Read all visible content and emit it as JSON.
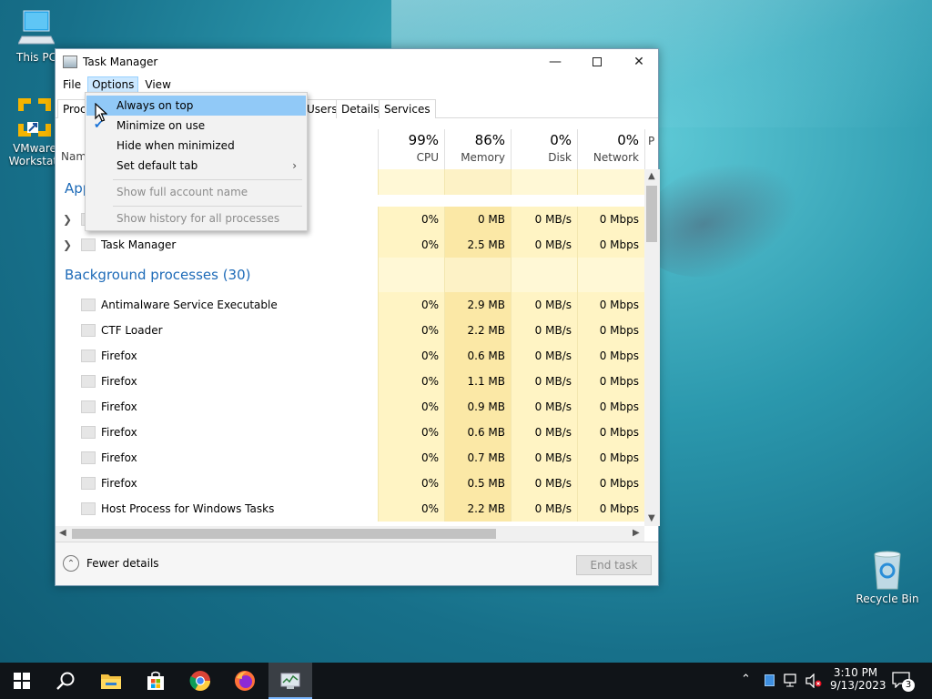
{
  "desktop": {
    "icons": [
      {
        "label": "This PC"
      },
      {
        "label": "VMware Workstati"
      },
      {
        "label": "Recycle Bin"
      }
    ]
  },
  "window": {
    "title": "Task Manager",
    "menu": [
      "File",
      "Options",
      "View"
    ],
    "tabs": [
      "Proc",
      "Users",
      "Details",
      "Services"
    ],
    "name_header": "Nam",
    "columns": [
      {
        "pct": "99%",
        "label": "CPU"
      },
      {
        "pct": "86%",
        "label": "Memory"
      },
      {
        "pct": "0%",
        "label": "Disk"
      },
      {
        "pct": "0%",
        "label": "Network"
      },
      {
        "pct": "",
        "label": "P"
      }
    ],
    "apps_group": "App",
    "apps": [
      {
        "name": "",
        "cpu": "0%",
        "mem": "0 MB",
        "disk": "0 MB/s",
        "net": "0 Mbps"
      },
      {
        "name": "Task Manager",
        "cpu": "0%",
        "mem": "2.5 MB",
        "disk": "0 MB/s",
        "net": "0 Mbps"
      }
    ],
    "bg_group": "Background processes (30)",
    "bg": [
      {
        "name": "Antimalware Service Executable",
        "cpu": "0%",
        "mem": "2.9 MB",
        "disk": "0 MB/s",
        "net": "0 Mbps"
      },
      {
        "name": "CTF Loader",
        "cpu": "0%",
        "mem": "2.2 MB",
        "disk": "0 MB/s",
        "net": "0 Mbps"
      },
      {
        "name": "Firefox",
        "cpu": "0%",
        "mem": "0.6 MB",
        "disk": "0 MB/s",
        "net": "0 Mbps"
      },
      {
        "name": "Firefox",
        "cpu": "0%",
        "mem": "1.1 MB",
        "disk": "0 MB/s",
        "net": "0 Mbps"
      },
      {
        "name": "Firefox",
        "cpu": "0%",
        "mem": "0.9 MB",
        "disk": "0 MB/s",
        "net": "0 Mbps"
      },
      {
        "name": "Firefox",
        "cpu": "0%",
        "mem": "0.6 MB",
        "disk": "0 MB/s",
        "net": "0 Mbps"
      },
      {
        "name": "Firefox",
        "cpu": "0%",
        "mem": "0.7 MB",
        "disk": "0 MB/s",
        "net": "0 Mbps"
      },
      {
        "name": "Firefox",
        "cpu": "0%",
        "mem": "0.5 MB",
        "disk": "0 MB/s",
        "net": "0 Mbps"
      },
      {
        "name": "Host Process for Windows Tasks",
        "cpu": "0%",
        "mem": "2.2 MB",
        "disk": "0 MB/s",
        "net": "0 Mbps"
      }
    ],
    "fewer_details": "Fewer details",
    "end_task": "End task"
  },
  "options_menu": {
    "items": [
      {
        "label": "Always on top",
        "checked": false,
        "highlighted": true,
        "disabled": false,
        "submenu": false
      },
      {
        "label": "Minimize on use",
        "checked": true,
        "highlighted": false,
        "disabled": false,
        "submenu": false
      },
      {
        "label": "Hide when minimized",
        "checked": false,
        "highlighted": false,
        "disabled": false,
        "submenu": false
      },
      {
        "label": "Set default tab",
        "checked": false,
        "highlighted": false,
        "disabled": false,
        "submenu": true
      },
      {
        "label": "Show full account name",
        "checked": false,
        "highlighted": false,
        "disabled": true,
        "submenu": false
      },
      {
        "label": "Show history for all processes",
        "checked": false,
        "highlighted": false,
        "disabled": true,
        "submenu": false
      }
    ]
  },
  "taskbar": {
    "time": "3:10 PM",
    "date": "9/13/2023",
    "notifications": "3",
    "pinned": [
      "start-icon",
      "search-icon",
      "file-explorer-icon",
      "store-icon",
      "chrome-icon",
      "firefox-icon",
      "task-manager-icon"
    ]
  }
}
